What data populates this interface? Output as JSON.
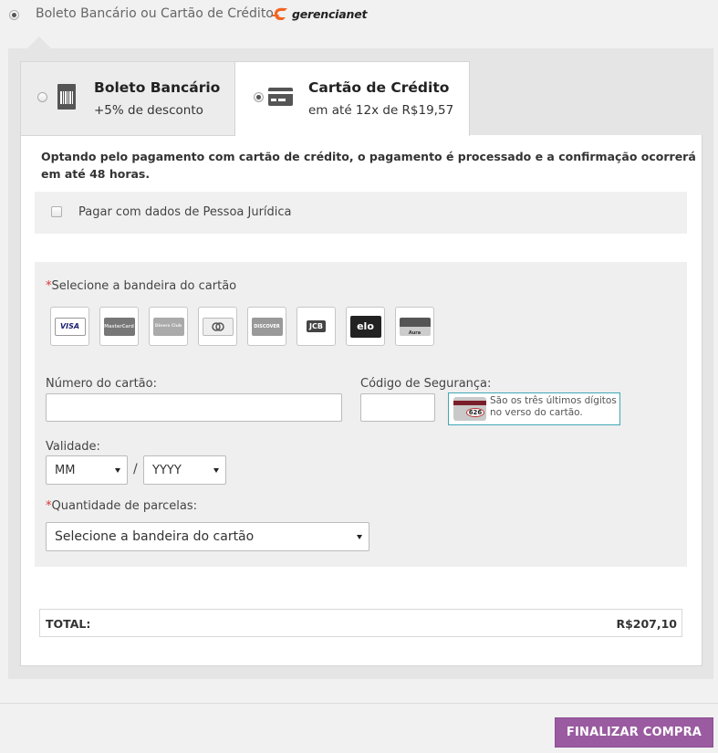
{
  "payment_option": {
    "label": "Boleto Bancário ou Cartão de Crédito",
    "brand": "gerencianet",
    "selected": true
  },
  "tabs": [
    {
      "title": "Boleto Bancário",
      "subtitle": "+5% de desconto",
      "selected": false,
      "icon": "barcode-icon"
    },
    {
      "title": "Cartão de Crédito",
      "subtitle": "em até 12x de R$19,57",
      "selected": true,
      "icon": "credit-card-icon"
    }
  ],
  "info_text": "Optando pelo pagamento com cartão de crédito, o pagamento é processado e a confirmação ocorrerá em até 48 horas.",
  "pj_checkbox": {
    "label": "Pagar com dados de Pessoa Jurídica",
    "checked": false
  },
  "card_form": {
    "flag_label_req": "*",
    "flag_label": "Selecione a bandeira do cartão",
    "flags": [
      {
        "name": "VISA",
        "color": "#1a1f71"
      },
      {
        "name": "MasterCard",
        "color": "#555555"
      },
      {
        "name": "Diners Club",
        "color": "#888888"
      },
      {
        "name": "",
        "color": "#666666"
      },
      {
        "name": "DISCOVER",
        "color": "#888888"
      },
      {
        "name": "JCB",
        "color": "#444444"
      },
      {
        "name": "elo",
        "color": "#222222"
      },
      {
        "name": "Aura",
        "color": "#777777"
      }
    ],
    "card_number_label": "Número do cartão:",
    "card_number_value": "",
    "cvv_label": "Código de Segurança:",
    "cvv_value": "",
    "cvv_hint": "São os três últimos dígitos no verso do cartão.",
    "cvv_sample": "626",
    "validity_label": "Validade:",
    "month_value": "MM",
    "year_value": "YYYY",
    "separator": "/",
    "installments_req": "*",
    "installments_label": "Quantidade de parcelas:",
    "installments_value": "Selecione a bandeira do cartão"
  },
  "total": {
    "label": "TOTAL:",
    "value": "R$207,10"
  },
  "submit_label": "FINALIZAR COMPRA",
  "colors": {
    "accent": "#9a5ba0",
    "required": "#d33333",
    "hint_border": "#3fa7b5"
  }
}
